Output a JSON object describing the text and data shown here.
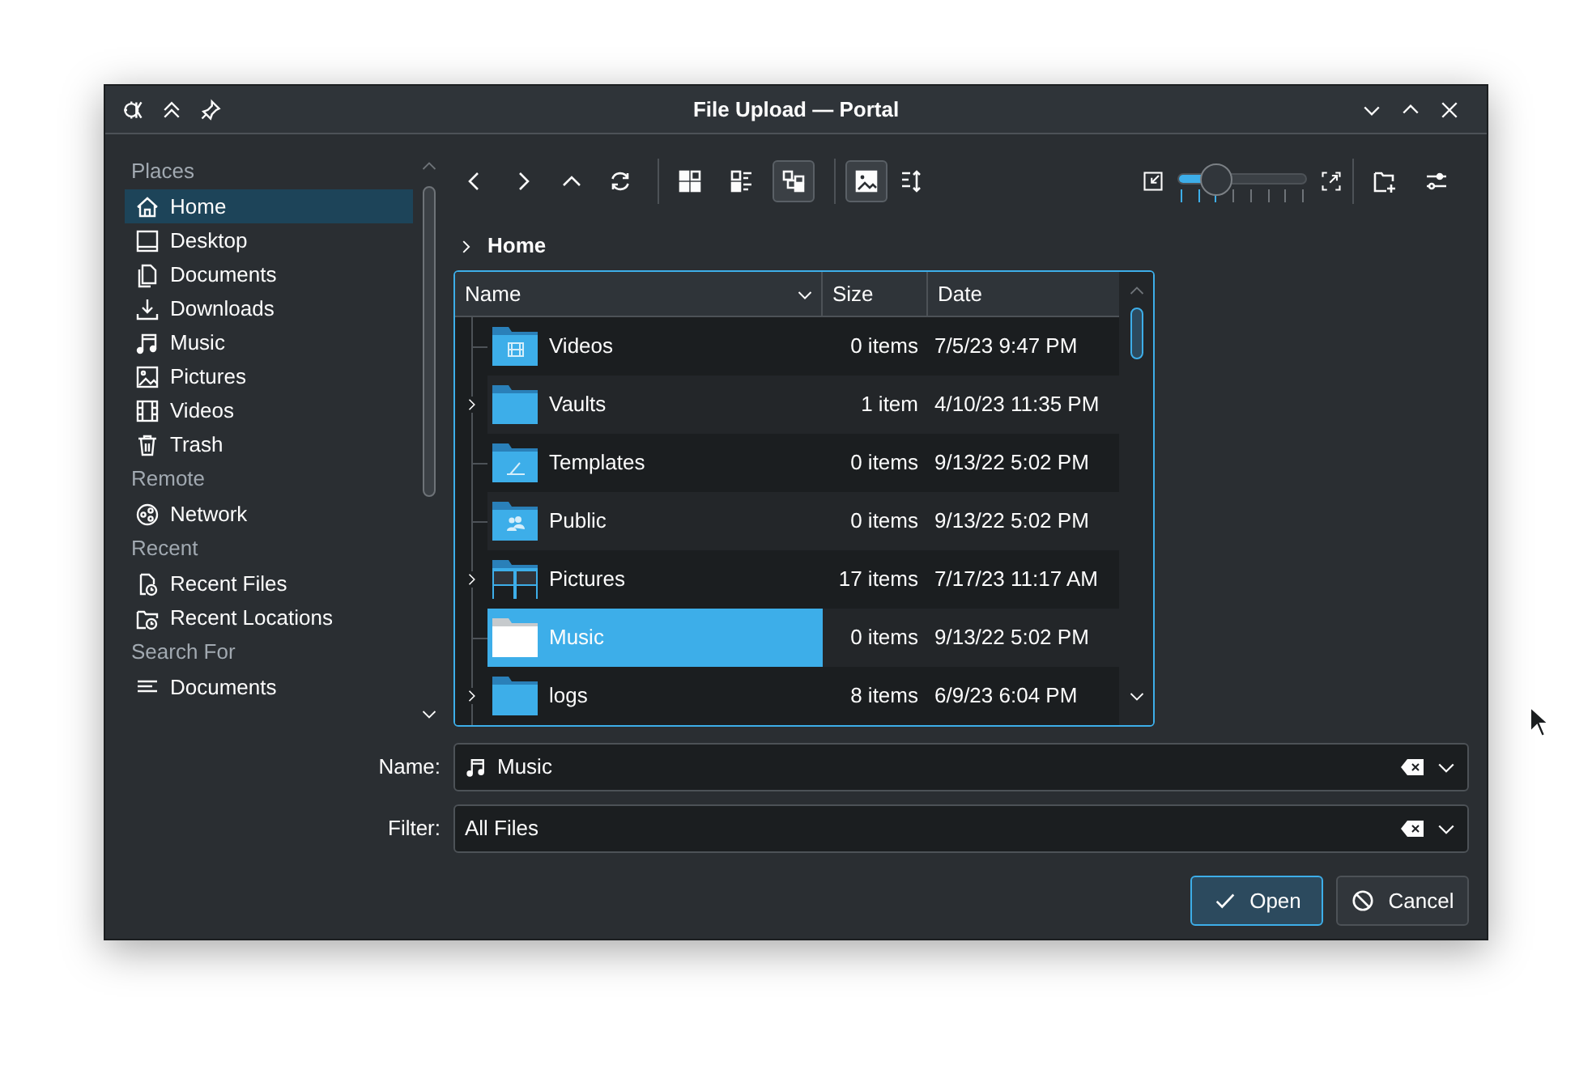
{
  "window": {
    "title": "File Upload — Portal"
  },
  "places": [
    {
      "heading": "Places",
      "items": [
        {
          "label": "Home",
          "kind": "home",
          "selected": true
        },
        {
          "label": "Desktop",
          "kind": "desktop",
          "selected": false
        },
        {
          "label": "Documents",
          "kind": "documents",
          "selected": false
        },
        {
          "label": "Downloads",
          "kind": "downloads",
          "selected": false
        },
        {
          "label": "Music",
          "kind": "music",
          "selected": false
        },
        {
          "label": "Pictures",
          "kind": "pictures",
          "selected": false
        },
        {
          "label": "Videos",
          "kind": "videos",
          "selected": false
        },
        {
          "label": "Trash",
          "kind": "trash",
          "selected": false
        }
      ]
    },
    {
      "heading": "Remote",
      "items": [
        {
          "label": "Network",
          "kind": "network",
          "selected": false
        }
      ]
    },
    {
      "heading": "Recent",
      "items": [
        {
          "label": "Recent Files",
          "kind": "recent-files",
          "selected": false
        },
        {
          "label": "Recent Locations",
          "kind": "recent-locations",
          "selected": false
        }
      ]
    },
    {
      "heading": "Search For",
      "items": [
        {
          "label": "Documents",
          "kind": "text-lines",
          "selected": false
        }
      ]
    }
  ],
  "toolbar": {
    "navigation": [
      {
        "kind": "back"
      },
      {
        "kind": "forward"
      },
      {
        "kind": "up"
      },
      {
        "kind": "reload"
      }
    ],
    "view_modes": [
      {
        "kind": "icons",
        "selected": false
      },
      {
        "kind": "compact",
        "selected": false
      },
      {
        "kind": "tree",
        "selected": true
      }
    ],
    "preview": {
      "selected": true
    },
    "zoom": {
      "level": 0.3
    },
    "actions": [
      {
        "kind": "new-folder"
      },
      {
        "kind": "options"
      }
    ]
  },
  "breadcrumb": {
    "label": "Home"
  },
  "table": {
    "columns": [
      {
        "label": "Name",
        "sorted": true
      },
      {
        "label": "Size",
        "sorted": false
      },
      {
        "label": "Date",
        "sorted": false
      }
    ],
    "rows": [
      {
        "name": "Videos",
        "size": "0 items",
        "date": "7/5/23 9:47 PM",
        "kind": "videos",
        "expandable": false,
        "selected": false
      },
      {
        "name": "Vaults",
        "size": "1 item",
        "date": "4/10/23 11:35 PM",
        "kind": "plain",
        "expandable": true,
        "selected": false
      },
      {
        "name": "Templates",
        "size": "0 items",
        "date": "9/13/22 5:02 PM",
        "kind": "templates",
        "expandable": false,
        "selected": false
      },
      {
        "name": "Public",
        "size": "0 items",
        "date": "9/13/22 5:02 PM",
        "kind": "public",
        "expandable": false,
        "selected": false
      },
      {
        "name": "Pictures",
        "size": "17 items",
        "date": "7/17/23 11:17 AM",
        "kind": "pictures",
        "expandable": true,
        "selected": false
      },
      {
        "name": "Music",
        "size": "0 items",
        "date": "9/13/22 5:02 PM",
        "kind": "plain",
        "expandable": false,
        "selected": true
      },
      {
        "name": "logs",
        "size": "8 items",
        "date": "6/9/23 6:04 PM",
        "kind": "plain",
        "expandable": true,
        "selected": false
      }
    ]
  },
  "name_field": {
    "label": "Name:",
    "value": "Music",
    "kind": "music"
  },
  "filter_field": {
    "label": "Filter:",
    "value": "All Files"
  },
  "buttons": [
    {
      "label": "Open",
      "kind": "open"
    },
    {
      "label": "Cancel",
      "kind": "cancel"
    }
  ]
}
